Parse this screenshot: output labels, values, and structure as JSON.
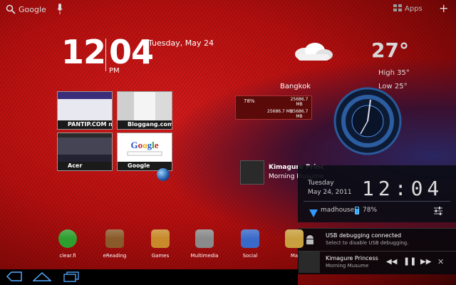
{
  "topbar": {
    "search_label": "Google",
    "apps_label": "Apps"
  },
  "clock": {
    "hour": "12",
    "minute": "04",
    "ampm": "PM",
    "date": "Tuesday, May 24"
  },
  "weather": {
    "temperature": "27°",
    "high": "High 35°",
    "low": "Low 25°",
    "city": "Bangkok"
  },
  "sysmon": {
    "battery": "78%",
    "value1": "25686.7 MB",
    "value2": "25686.7 MB",
    "value3": "25686.7 MB"
  },
  "thumbnails": [
    {
      "label": "PANTIP.COM n...",
      "icon": "pantip-icon"
    },
    {
      "label": "Bloggang.com...",
      "icon": "bloggang-icon"
    },
    {
      "label": "Acer",
      "icon": "acer-icon"
    },
    {
      "label": "Google",
      "icon": "google-icon"
    }
  ],
  "music_widget": {
    "title": "Kimagure Princ",
    "artist": "Morning Musume"
  },
  "notif_panel": {
    "day": "Tuesday",
    "date": "May 24, 2011",
    "time": "12:04",
    "network": "madhouse",
    "battery": "78%"
  },
  "notifications": [
    {
      "title": "USB debugging connected",
      "subtitle": "Select to disable USB debugging."
    },
    {
      "title": "Kimagure Princess",
      "subtitle": "Morning Musume"
    }
  ],
  "dock": [
    {
      "label": "clear.fi",
      "color": "#2e9e2e"
    },
    {
      "label": "eReading",
      "color": "#8a5a2a"
    },
    {
      "label": "Games",
      "color": "#c88a2a"
    },
    {
      "label": "Multimedia",
      "color": "#8a8a8a"
    },
    {
      "label": "Social",
      "color": "#3a6ac8"
    },
    {
      "label": "Ma",
      "color": "#c8a040"
    }
  ],
  "colors": {
    "wallpaper": "#b50f0f",
    "panel": "#0a0c14",
    "accent": "#33aaff"
  }
}
